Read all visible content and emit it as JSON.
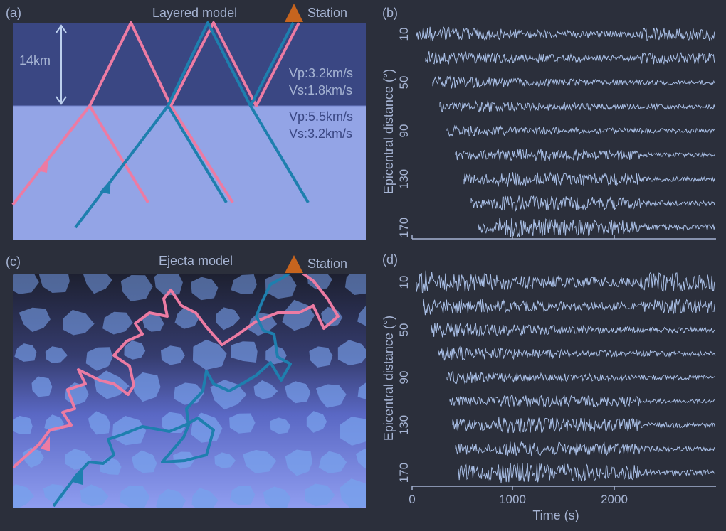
{
  "panels": {
    "a": {
      "label": "(a)",
      "title": "Layered model",
      "station": "Station",
      "thickness": "14km",
      "layer1": {
        "vp": "Vp:3.2km/s",
        "vs": "Vs:1.8km/s"
      },
      "layer2": {
        "vp": "Vp:5.5km/s",
        "vs": "Vs:3.2km/s"
      }
    },
    "b": {
      "label": "(b)",
      "ylabel": "Epicentral distance (°)",
      "ticks": [
        "10",
        "50",
        "90",
        "130",
        "170"
      ]
    },
    "c": {
      "label": "(c)",
      "title": "Ejecta model",
      "station": "Station"
    },
    "d": {
      "label": "(d)",
      "ylabel": "Epicentral distance (°)",
      "ticks": [
        "10",
        "50",
        "90",
        "130",
        "170"
      ],
      "xlabel": "Time (s)",
      "xticks": [
        "0",
        "1000",
        "2000"
      ]
    }
  },
  "colors": {
    "background": "#2b2f3b",
    "upper_layer": "#3a4783",
    "lower_layer": "#93a4e6",
    "ray_pink": "#ec7ba3",
    "ray_blue": "#1e7fae",
    "station": "#c6641e",
    "trace": "#a9bfe6"
  }
}
